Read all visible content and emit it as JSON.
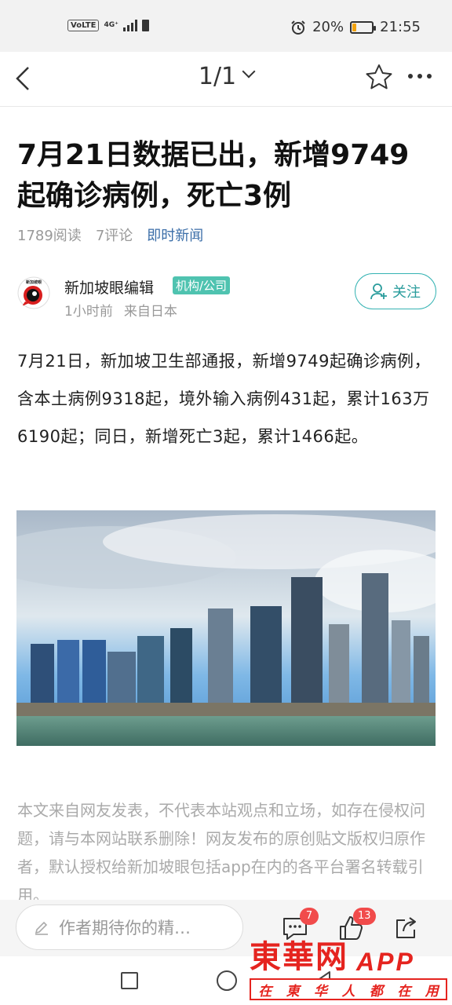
{
  "status_bar": {
    "volte": "VoLTE",
    "network": "4G⁺",
    "battery_pct": "20%",
    "battery_level": 0.2,
    "time": "21:55"
  },
  "topbar": {
    "page_indicator": "1/1"
  },
  "article": {
    "title": "7月21日数据已出，新增9749起确诊病例，死亡3例",
    "reads": "1789阅读",
    "comments": "7评论",
    "category": "即时新闻",
    "author": "新加坡眼编辑",
    "author_badge": "机构/公司",
    "time_ago": "1小时前",
    "source": "来自日本",
    "follow_label": "关注",
    "body": "7月21日，新加坡卫生部通报，新增9749起确诊病例，含本土病例9318起，境外输入病例431起，累计163万6190起；同日，新增死亡3起，累计1466起。",
    "disclaimer": "本文来自网友发表，不代表本站观点和立场，如存在侵权问题，请与本网站联系删除！网友发布的原创贴文版权归原作者，默认授权给新加坡眼包括app在内的各平台署名转载引用。"
  },
  "bottom_bar": {
    "comment_placeholder": "作者期待你的精…",
    "comment_count": "7",
    "like_count": "13"
  },
  "watermark": {
    "brand": "東華网",
    "app": "APP",
    "slogan": [
      "在",
      "東",
      "华",
      "人",
      "都",
      "在",
      "用"
    ]
  }
}
